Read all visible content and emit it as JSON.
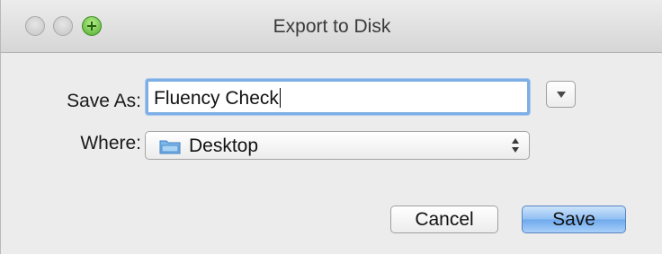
{
  "window": {
    "title": "Export to Disk"
  },
  "form": {
    "save_as_label": "Save As:",
    "save_as_value": "Fluency Check",
    "where_label": "Where:",
    "where_value": "Desktop"
  },
  "buttons": {
    "cancel": "Cancel",
    "save": "Save"
  },
  "colors": {
    "focus_ring": "#7eaee6",
    "default_button": "#8fbff2",
    "zoom_button": "#4faa2e"
  },
  "icons": {
    "folder": "folder-icon",
    "popup_arrows": "up-down-arrows-icon",
    "disclosure": "disclosure-triangle-icon"
  }
}
